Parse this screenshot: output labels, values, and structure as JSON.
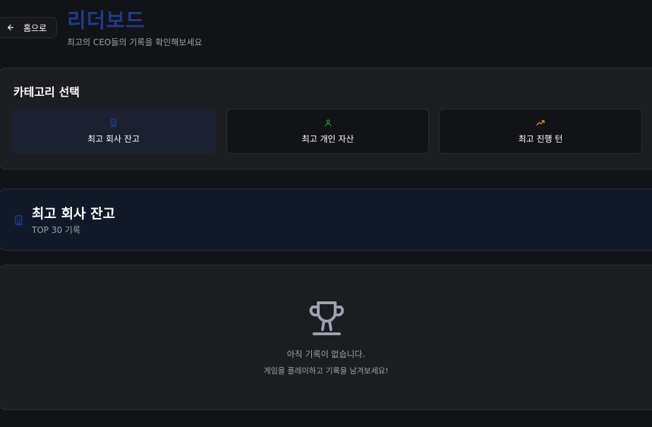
{
  "header": {
    "back_label": "홈으로",
    "title": "리더보드",
    "subtitle": "최고의 CEO들의 기록을 확인해보세요"
  },
  "categories": {
    "heading": "카테고리 선택",
    "items": [
      {
        "label": "최고 회사 잔고",
        "icon": "building-icon",
        "color": "#1e40af",
        "active": true
      },
      {
        "label": "최고 개인 자산",
        "icon": "user-icon",
        "color": "#22c55e",
        "active": false
      },
      {
        "label": "최고 진행 턴",
        "icon": "trending-up-icon",
        "color": "#f59e0b",
        "active": false
      }
    ]
  },
  "selected": {
    "title": "최고 회사 잔고",
    "subtitle": "TOP 30 기록",
    "icon": "building-icon"
  },
  "empty": {
    "icon": "trophy-icon",
    "message": "아직 기록이 없습니다.",
    "hint": "게임을 플레이하고 기록을 남겨보세요!"
  },
  "colors": {
    "background": "#121316",
    "card": "#1c1d21",
    "accent": "#1e3a8a",
    "muted": "#9ca3af"
  }
}
